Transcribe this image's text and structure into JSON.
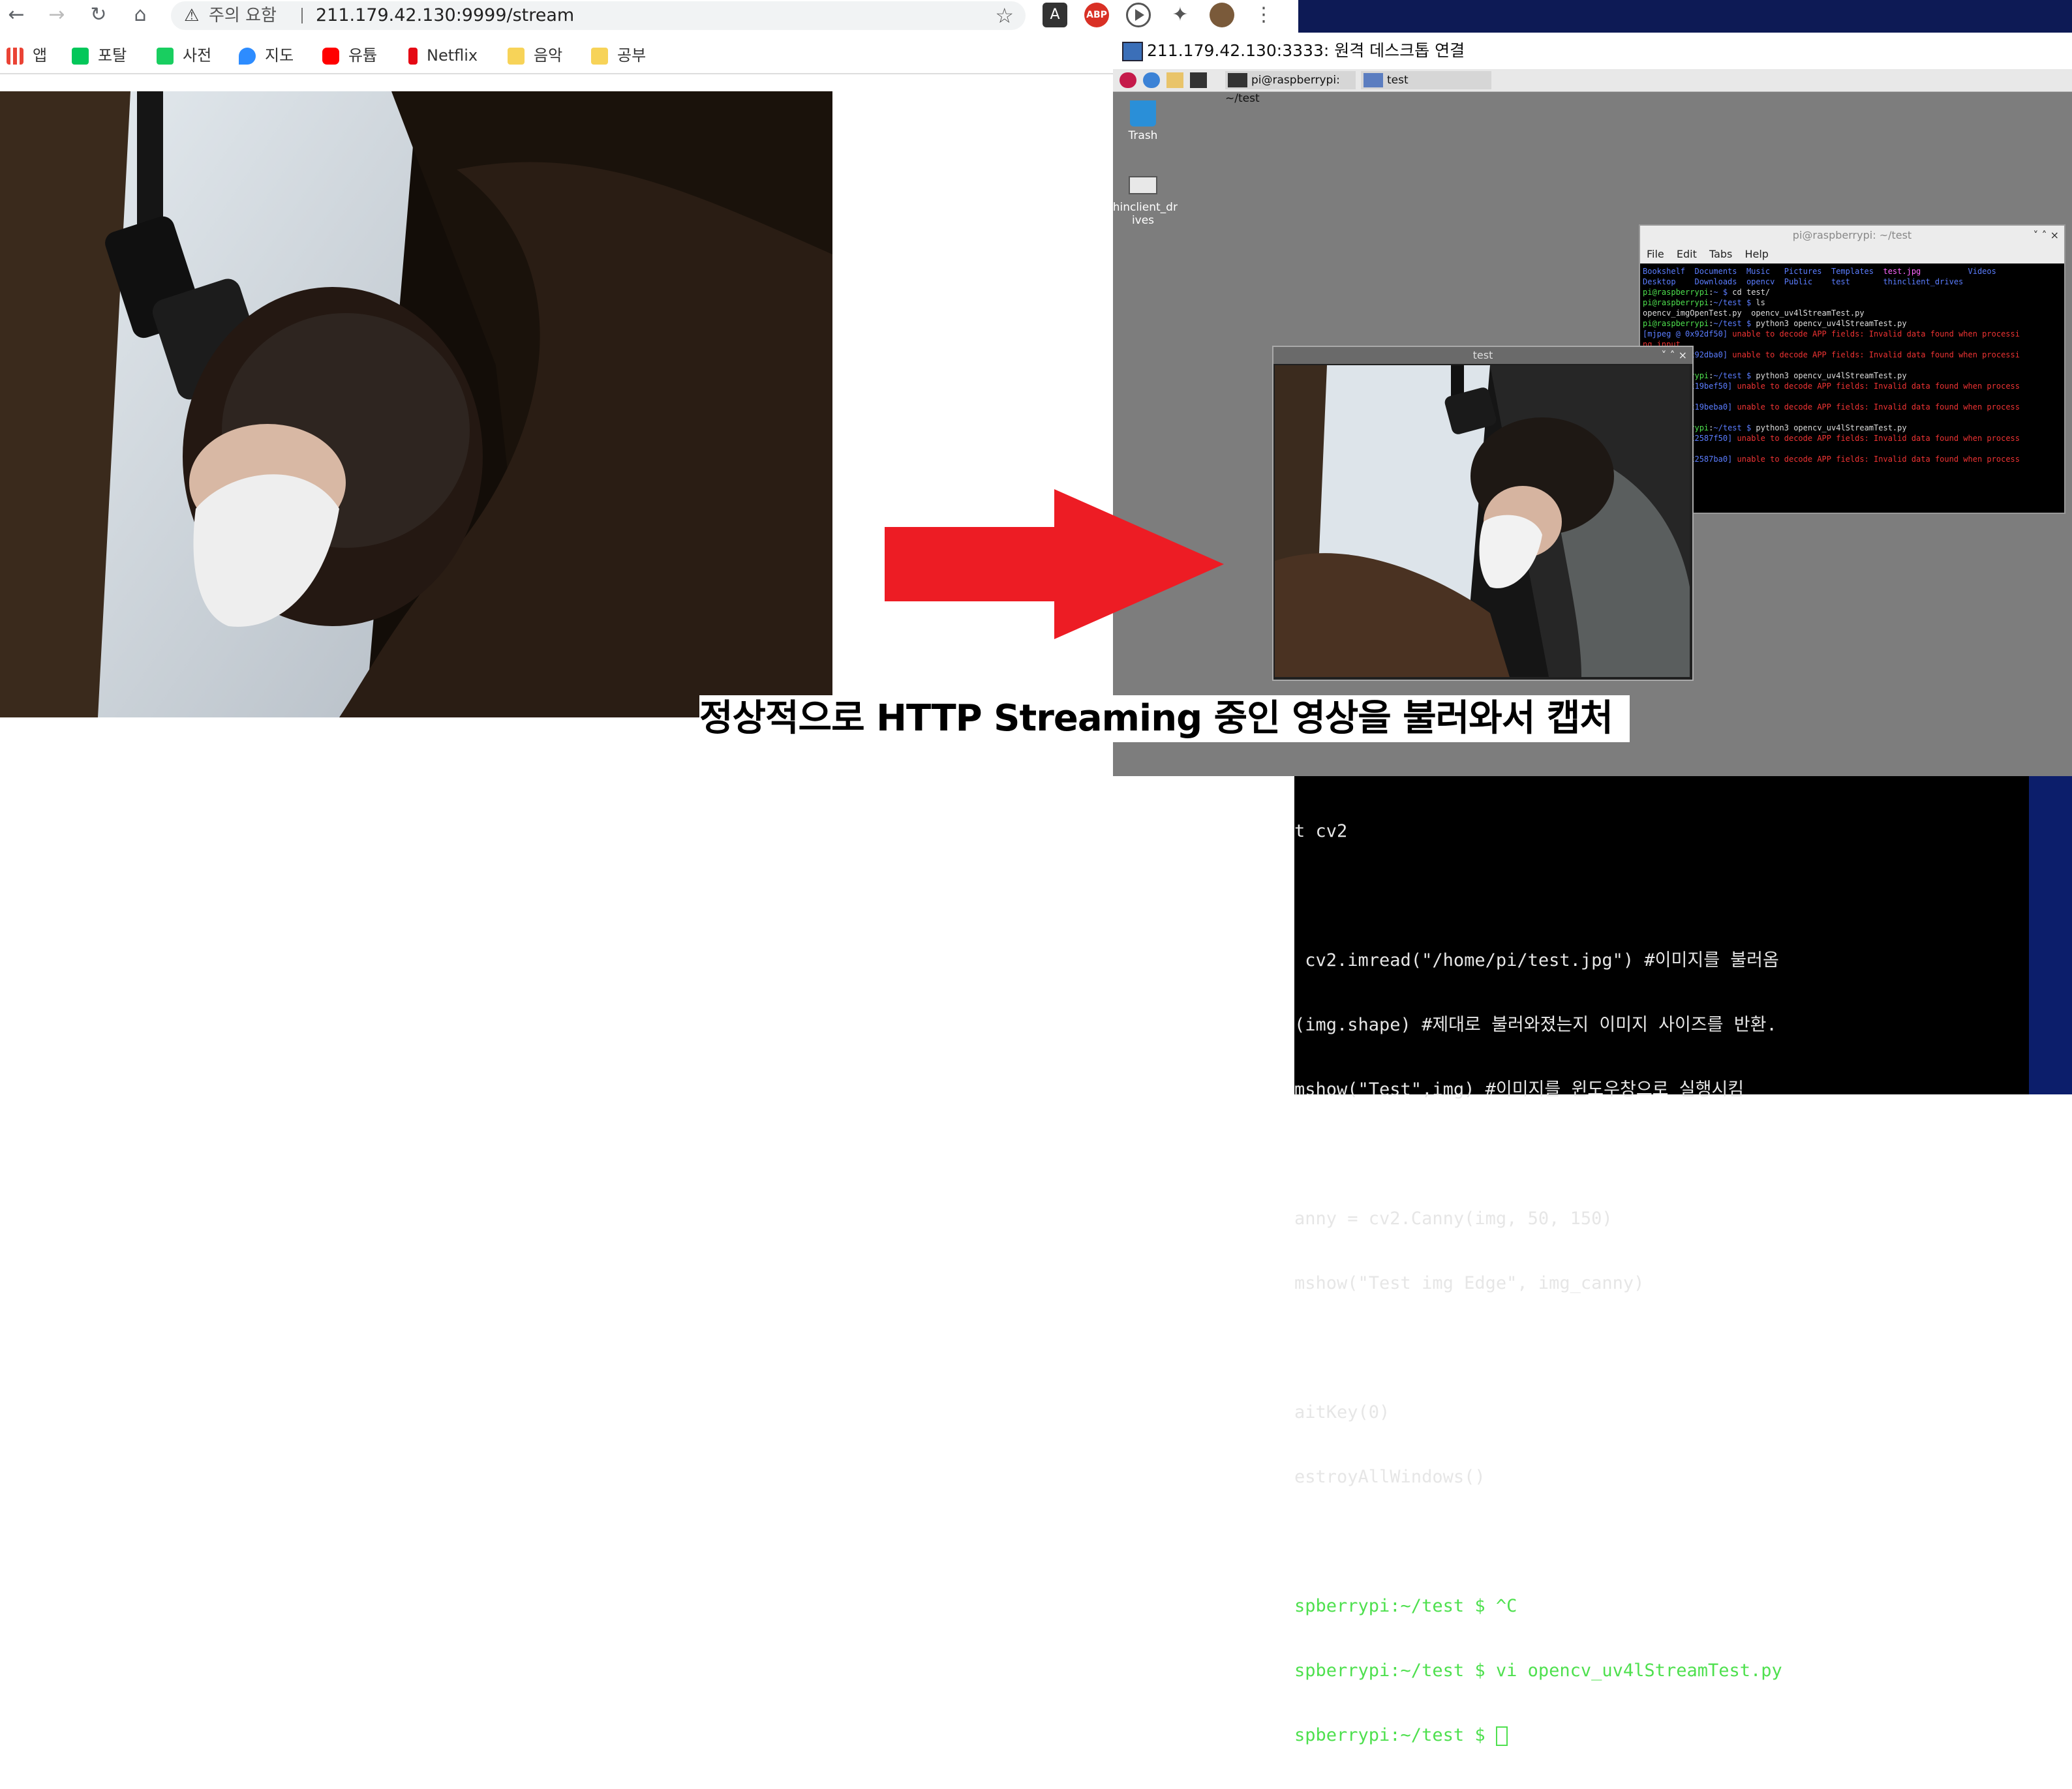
{
  "browser": {
    "security_label": "주의 요함",
    "url": "211.179.42.130:9999/stream",
    "bookmarks": [
      {
        "label": "앱",
        "color": "#ea4335"
      },
      {
        "label": "포탈",
        "color": "#03c75a"
      },
      {
        "label": "사전",
        "color": "#19ce60"
      },
      {
        "label": "지도",
        "color": "#2d8cff"
      },
      {
        "label": "유튭",
        "color": "#ff0000"
      },
      {
        "label": "Netflix",
        "color": "#e50914"
      },
      {
        "label": "음악",
        "color": "#f7d358"
      },
      {
        "label": "공부",
        "color": "#f7d358"
      }
    ],
    "extensions": [
      "translate-icon",
      "adblock-icon",
      "play-icon",
      "puzzle-icon",
      "avatar",
      "kebab-menu-icon"
    ],
    "adblock_label": "ABP"
  },
  "rdp": {
    "title": "211.179.42.130:3333: 원격 데스크톱 연결",
    "panel_task1": "pi@raspberrypi: ~/test",
    "panel_task2": "test",
    "desktop_icons": [
      {
        "label": "Trash",
        "icon": "trash-icon"
      },
      {
        "label": "thinclient_drives",
        "icon": "drive-icon"
      }
    ],
    "terminal": {
      "title": "pi@raspberrypi: ~/test",
      "menu": [
        "File",
        "Edit",
        "Tabs",
        "Help"
      ]
    },
    "cv_window_title": "test"
  },
  "vi_lines": [
    "t cv2",
    "",
    " cv2.imread(\"/home/pi/test.jpg\") #이미지를 불러옴",
    "(img.shape) #제대로 불러와졌는지 이미지 사이즈를 반환.",
    "mshow(\"Test\",img) #이미지를 윈도우창으로 실행시킴",
    "",
    "anny = cv2.Canny(img, 50, 150)",
    "mshow(\"Test img Edge\", img_canny)",
    "",
    "aitKey(0)",
    "estroyAllWindows()",
    "",
    "spberrypi:~/test $ ^C",
    "spberrypi:~/test $ vi opencv_uv4lStreamTest.py",
    "spberrypi:~/test $ "
  ],
  "caption": "정상적으로 HTTP Streaming 중인 영상을 불러와서 캡처",
  "colors": {
    "arrow": "#ed1c24",
    "rdp_desktop": "#7d7d7d",
    "terminal_prompt": "#4ee04e"
  }
}
